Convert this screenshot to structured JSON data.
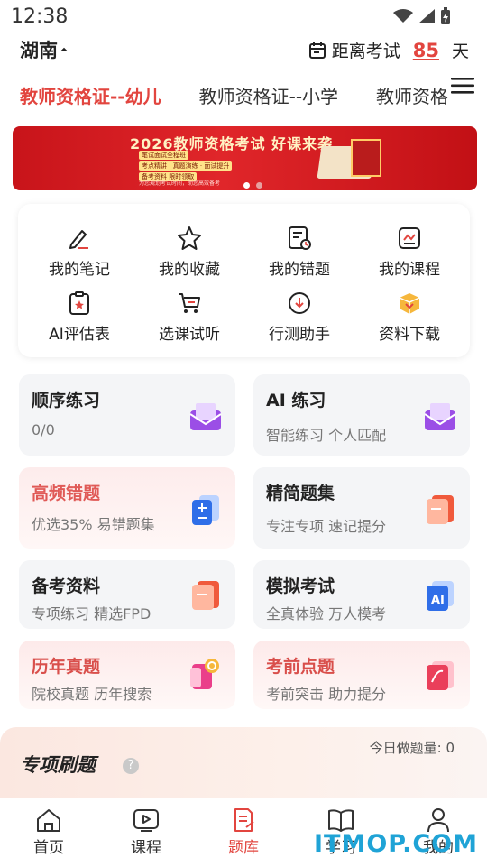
{
  "status": {
    "time": "12:38"
  },
  "header": {
    "region": "湖南",
    "countdown_label": "距离考试",
    "countdown_days": "85",
    "countdown_unit": "天"
  },
  "tabs": [
    {
      "label": "教师资格证--幼儿",
      "active": true
    },
    {
      "label": "教师资格证--小学",
      "active": false
    },
    {
      "label": "教师资格",
      "active": false
    }
  ],
  "banner": {
    "title": "2026教师资格考试 好课来袭",
    "tags": [
      "笔试面试全程班",
      "考点精讲 · 真题演练 · 面试提升",
      "备考资料 限时领取"
    ],
    "small": "为您规划考试时间，助您高效备考"
  },
  "quick_menu": [
    {
      "label": "我的笔记",
      "icon": "note-pen-icon"
    },
    {
      "label": "我的收藏",
      "icon": "star-icon"
    },
    {
      "label": "我的错题",
      "icon": "wrong-question-icon"
    },
    {
      "label": "我的课程",
      "icon": "course-icon"
    },
    {
      "label": "AI评估表",
      "icon": "clipboard-star-icon"
    },
    {
      "label": "选课试听",
      "icon": "cart-icon"
    },
    {
      "label": "行测助手",
      "icon": "cloud-download-icon"
    },
    {
      "label": "资料下载",
      "icon": "box-download-icon"
    }
  ],
  "practice": [
    {
      "title": "顺序练习",
      "subtitle": "0/0",
      "icon": "envelope-icon",
      "accent": "#8b3fd9"
    },
    {
      "title": "AI 练习",
      "subtitle": "智能练习 个人匹配",
      "icon": "envelope-icon",
      "accent": "#8b3fd9"
    },
    {
      "title": "高频错题",
      "subtitle": "优选35% 易错题集",
      "icon": "calculator-icon",
      "accent": "#2f6ee8"
    },
    {
      "title": "精简题集",
      "subtitle": "专注专项 速记提分",
      "icon": "folder-icon",
      "accent": "#f05a3c"
    },
    {
      "title": "备考资料",
      "subtitle": "专项练习 精选FPD",
      "icon": "folder-icon",
      "accent": "#f05a3c"
    },
    {
      "title": "模拟考试",
      "subtitle": "全真体验 万人模考",
      "icon": "ai-exam-icon",
      "accent": "#2f6ee8"
    },
    {
      "title": "历年真题",
      "subtitle": "院校真题 历年搜索",
      "icon": "search-paper-icon",
      "accent": "#ea3f8a"
    },
    {
      "title": "考前点题",
      "subtitle": "考前突击 助力提分",
      "icon": "book-icon",
      "accent": "#ea3f5a"
    }
  ],
  "special": {
    "title": "专项刷题",
    "help": "?",
    "today_count": "今日做题量: 0"
  },
  "bottom_nav": [
    {
      "label": "首页",
      "icon": "home-icon",
      "active": false
    },
    {
      "label": "课程",
      "icon": "play-course-icon",
      "active": false
    },
    {
      "label": "题库",
      "icon": "question-bank-icon",
      "active": true
    },
    {
      "label": "学习",
      "icon": "open-book-icon",
      "active": false
    },
    {
      "label": "我的",
      "icon": "user-icon",
      "active": false
    }
  ],
  "watermark": "ITMOP.COM",
  "colors": {
    "accent": "#e2453f",
    "banner_red": "#d61d22"
  }
}
